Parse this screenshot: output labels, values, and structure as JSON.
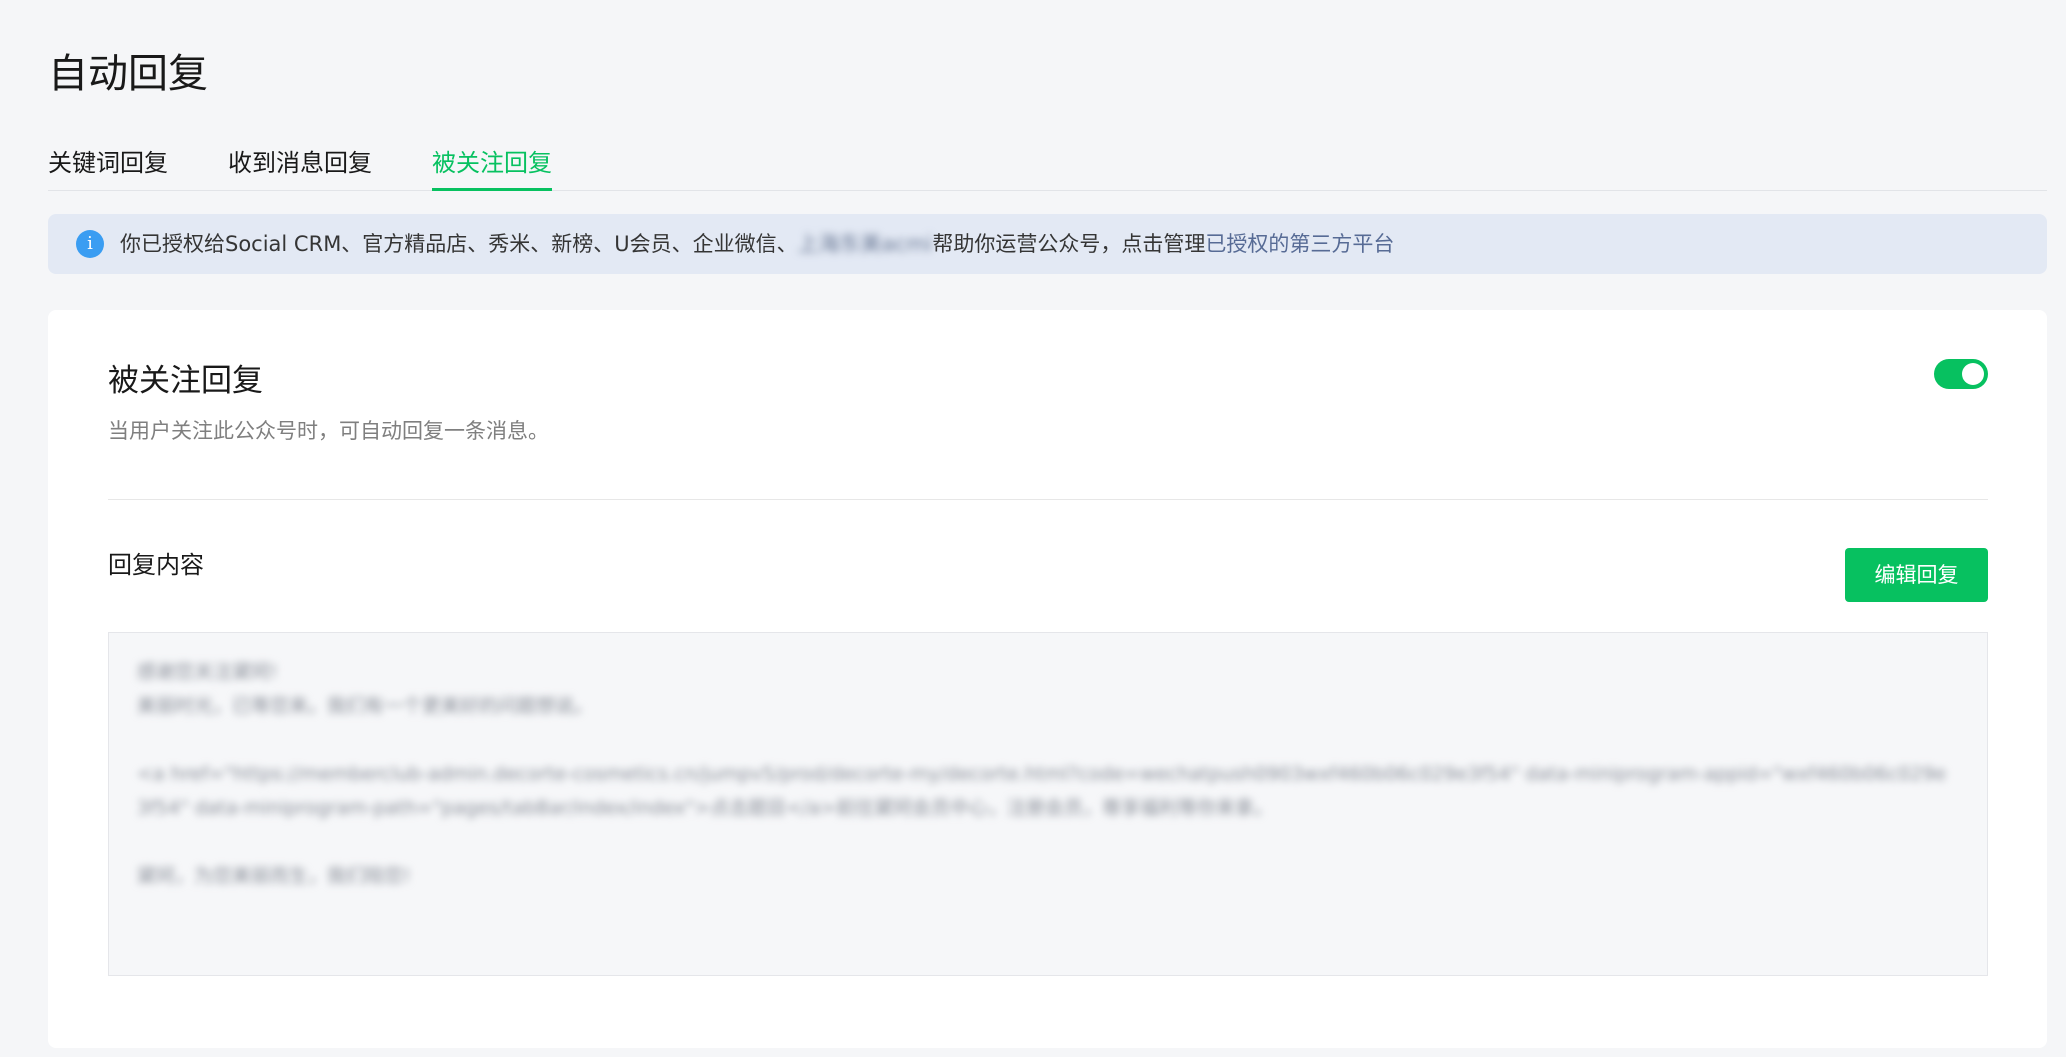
{
  "page": {
    "title": "自动回复"
  },
  "tabs": [
    {
      "label": "关键词回复",
      "active": false
    },
    {
      "label": "收到消息回复",
      "active": false
    },
    {
      "label": "被关注回复",
      "active": true
    }
  ],
  "notice": {
    "icon": "info-icon",
    "prefix": "你已授权给Social CRM、官方精品店、秀米、新榜、U会员、企业微信、",
    "blurred_name": "上海东美acmi",
    "middle": "帮助你运营公众号，点击管理",
    "link": "已授权的第三方平台"
  },
  "follow_reply": {
    "title": "被关注回复",
    "description": "当用户关注此公众号时，可自动回复一条消息。",
    "toggle_on": true
  },
  "reply_section": {
    "label": "回复内容",
    "edit_button": "编辑回复",
    "content": "感谢您关注黛珂!\n美丽时光，已等您来。我们有一个更美好的问题想说。\n\n<a href=\"https://memberclub-admin.decorte-cosmetics.cn/jumpv5/prod/decorte-my/decorte.html?code=wechatpush0903wxf460b06c029e3f54\" data-miniprogram-appid=\"wxf460b06c029e3f54\" data-miniprogram-path=\"pages/tabBar/index/index\">点击题目</a>前往黛珂会员中心，注册会员，尊享福利等你来拿。\n\n黛珂，为您美丽而生，我们陪您!"
  },
  "colors": {
    "accent": "#07c160",
    "link": "#576b95",
    "notice_bg": "#e3e9f4",
    "info_icon": "#3a9df2"
  }
}
